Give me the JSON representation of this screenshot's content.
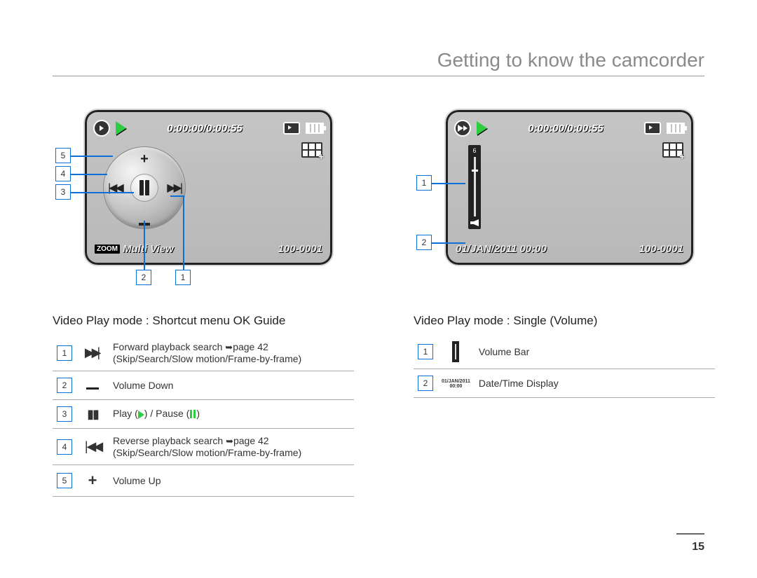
{
  "page_title": "Getting to know the camcorder",
  "page_number": "15",
  "left": {
    "time": "0:00:00/0:00:55",
    "bottom_label": "Multi View",
    "file_num": "100-0001",
    "section_title": "Video Play mode : Shortcut menu OK Guide",
    "callouts": {
      "c1": "1",
      "c2": "2",
      "c3": "3",
      "c4": "4",
      "c5": "5"
    },
    "rows": [
      {
        "n": "1",
        "icon": "ff",
        "text": "Forward playback search ➥page 42\n(Skip/Search/Slow motion/Frame-by-frame)"
      },
      {
        "n": "2",
        "icon": "minus",
        "text": "Volume Down"
      },
      {
        "n": "3",
        "icon": "pause",
        "text": "Play ( ▶ ) / Pause ( ▮▮ )"
      },
      {
        "n": "4",
        "icon": "rw",
        "text": "Reverse playback search ➥page 42\n(Skip/Search/Slow motion/Frame-by-frame)"
      },
      {
        "n": "5",
        "icon": "plus",
        "text": "Volume Up"
      }
    ]
  },
  "right": {
    "time": "0:00:00/0:00:55",
    "date": "01/JAN/2011 00:00",
    "file_num": "100-0001",
    "vol_level": "6",
    "section_title": "Video Play mode : Single (Volume)",
    "callouts": {
      "c1": "1",
      "c2": "2"
    },
    "rows": [
      {
        "n": "1",
        "icon": "volbar",
        "text": "Volume Bar"
      },
      {
        "n": "2",
        "icon": "date",
        "text": "Date/Time Display"
      }
    ]
  }
}
